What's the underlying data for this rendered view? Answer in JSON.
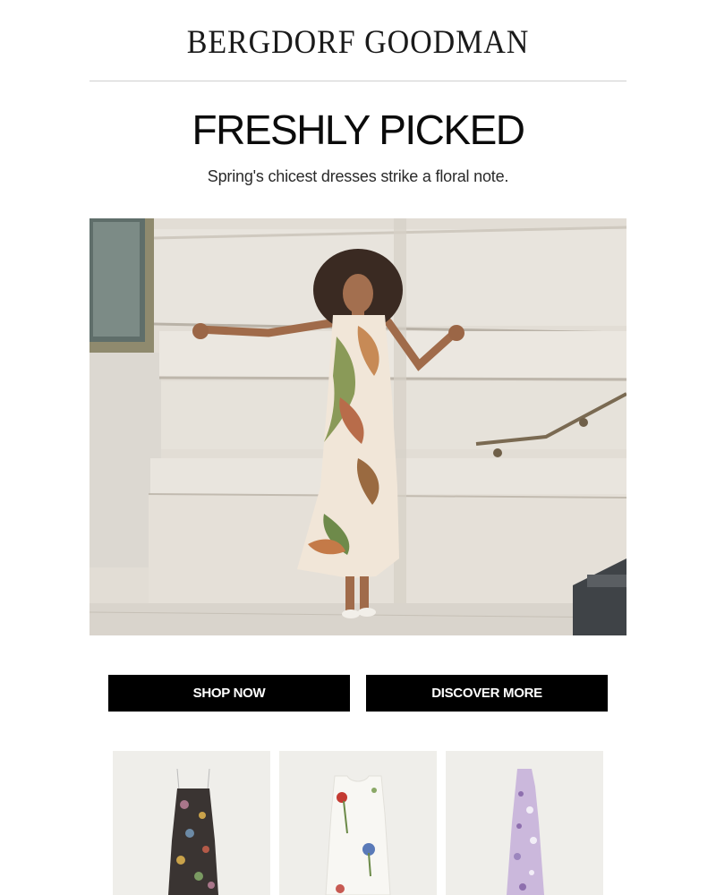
{
  "brand": {
    "logo_text": "BERGDORF GOODMAN"
  },
  "hero": {
    "headline": "FRESHLY PICKED",
    "subhead": "Spring's chicest dresses strike a floral note.",
    "image_alt": "Model in a cream floral slip dress posing against a stone building wall"
  },
  "buttons": {
    "shop_now": "SHOP NOW",
    "discover_more": "DISCOVER MORE"
  },
  "products": [
    {
      "image_alt": "Dark multicolor floral slip dress"
    },
    {
      "image_alt": "White shift dress with painted flowers"
    },
    {
      "image_alt": "Lavender floral halter dress"
    }
  ],
  "colors": {
    "button_bg": "#000000",
    "button_text": "#ffffff",
    "divider": "#cfcfcf",
    "tile_bg": "#efeeea"
  }
}
